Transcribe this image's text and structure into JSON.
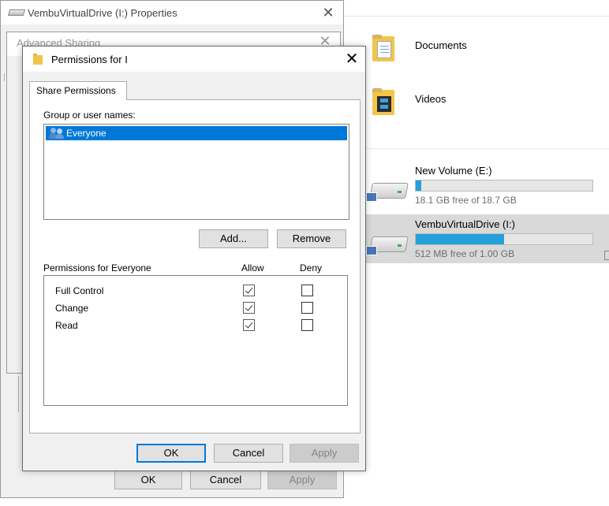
{
  "explorer": {
    "folders": [
      {
        "name": "Documents",
        "icon": "documents-folder-icon"
      },
      {
        "name": "Videos",
        "icon": "videos-folder-icon"
      }
    ],
    "drives": [
      {
        "name": "New Volume (E:)",
        "free_text": "18.1 GB free of 18.7 GB",
        "used_fraction": 0.03,
        "selected": false
      },
      {
        "name": "VembuVirtualDrive (I:)",
        "free_text": "512 MB free of 1.00 GB",
        "used_fraction": 0.5,
        "selected": true
      }
    ],
    "colors": {
      "bar_fill": "#26a0da",
      "selection": "#d9d9d9"
    }
  },
  "properties_window": {
    "title": "VembuVirtualDrive (I:) Properties",
    "ok_label": "OK",
    "cancel_label": "Cancel",
    "apply_label": "Apply"
  },
  "advanced_sharing_window": {
    "title": "Advanced Sharing"
  },
  "permissions_window": {
    "title": "Permissions for I",
    "tab_label": "Share Permissions",
    "group_label": "Group or user names:",
    "users": [
      "Everyone"
    ],
    "add_label": "Add...",
    "remove_label": "Remove",
    "permissions_header": "Permissions for Everyone",
    "allow_header": "Allow",
    "deny_header": "Deny",
    "permissions": [
      {
        "name": "Full Control",
        "allow": true,
        "deny": false
      },
      {
        "name": "Change",
        "allow": true,
        "deny": false
      },
      {
        "name": "Read",
        "allow": true,
        "deny": false
      }
    ],
    "ok_label": "OK",
    "cancel_label": "Cancel",
    "apply_label": "Apply",
    "colors": {
      "selection": "#0078d7"
    }
  }
}
